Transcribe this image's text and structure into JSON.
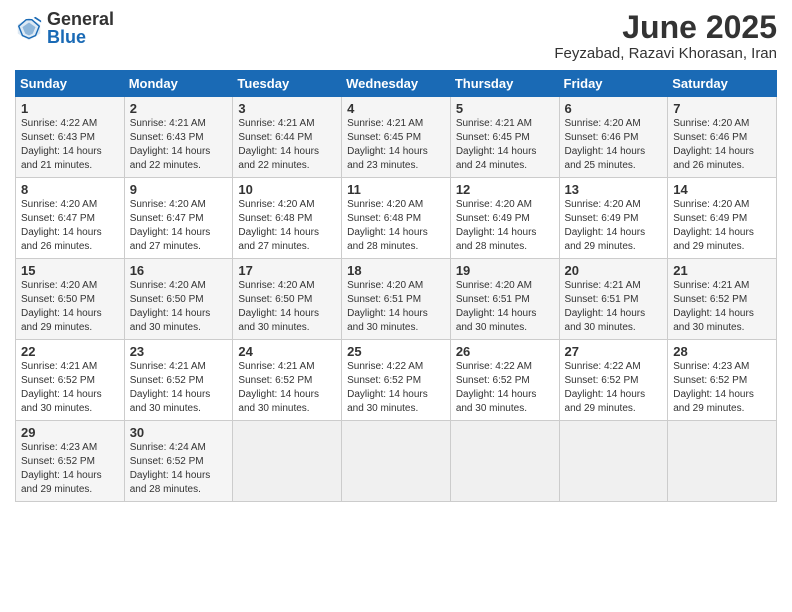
{
  "header": {
    "logo_general": "General",
    "logo_blue": "Blue",
    "title": "June 2025",
    "subtitle": "Feyzabad, Razavi Khorasan, Iran"
  },
  "weekdays": [
    "Sunday",
    "Monday",
    "Tuesday",
    "Wednesday",
    "Thursday",
    "Friday",
    "Saturday"
  ],
  "weeks": [
    [
      {
        "day": "1",
        "info": "Sunrise: 4:22 AM\nSunset: 6:43 PM\nDaylight: 14 hours\nand 21 minutes."
      },
      {
        "day": "2",
        "info": "Sunrise: 4:21 AM\nSunset: 6:43 PM\nDaylight: 14 hours\nand 22 minutes."
      },
      {
        "day": "3",
        "info": "Sunrise: 4:21 AM\nSunset: 6:44 PM\nDaylight: 14 hours\nand 22 minutes."
      },
      {
        "day": "4",
        "info": "Sunrise: 4:21 AM\nSunset: 6:45 PM\nDaylight: 14 hours\nand 23 minutes."
      },
      {
        "day": "5",
        "info": "Sunrise: 4:21 AM\nSunset: 6:45 PM\nDaylight: 14 hours\nand 24 minutes."
      },
      {
        "day": "6",
        "info": "Sunrise: 4:20 AM\nSunset: 6:46 PM\nDaylight: 14 hours\nand 25 minutes."
      },
      {
        "day": "7",
        "info": "Sunrise: 4:20 AM\nSunset: 6:46 PM\nDaylight: 14 hours\nand 26 minutes."
      }
    ],
    [
      {
        "day": "8",
        "info": "Sunrise: 4:20 AM\nSunset: 6:47 PM\nDaylight: 14 hours\nand 26 minutes."
      },
      {
        "day": "9",
        "info": "Sunrise: 4:20 AM\nSunset: 6:47 PM\nDaylight: 14 hours\nand 27 minutes."
      },
      {
        "day": "10",
        "info": "Sunrise: 4:20 AM\nSunset: 6:48 PM\nDaylight: 14 hours\nand 27 minutes."
      },
      {
        "day": "11",
        "info": "Sunrise: 4:20 AM\nSunset: 6:48 PM\nDaylight: 14 hours\nand 28 minutes."
      },
      {
        "day": "12",
        "info": "Sunrise: 4:20 AM\nSunset: 6:49 PM\nDaylight: 14 hours\nand 28 minutes."
      },
      {
        "day": "13",
        "info": "Sunrise: 4:20 AM\nSunset: 6:49 PM\nDaylight: 14 hours\nand 29 minutes."
      },
      {
        "day": "14",
        "info": "Sunrise: 4:20 AM\nSunset: 6:49 PM\nDaylight: 14 hours\nand 29 minutes."
      }
    ],
    [
      {
        "day": "15",
        "info": "Sunrise: 4:20 AM\nSunset: 6:50 PM\nDaylight: 14 hours\nand 29 minutes."
      },
      {
        "day": "16",
        "info": "Sunrise: 4:20 AM\nSunset: 6:50 PM\nDaylight: 14 hours\nand 30 minutes."
      },
      {
        "day": "17",
        "info": "Sunrise: 4:20 AM\nSunset: 6:50 PM\nDaylight: 14 hours\nand 30 minutes."
      },
      {
        "day": "18",
        "info": "Sunrise: 4:20 AM\nSunset: 6:51 PM\nDaylight: 14 hours\nand 30 minutes."
      },
      {
        "day": "19",
        "info": "Sunrise: 4:20 AM\nSunset: 6:51 PM\nDaylight: 14 hours\nand 30 minutes."
      },
      {
        "day": "20",
        "info": "Sunrise: 4:21 AM\nSunset: 6:51 PM\nDaylight: 14 hours\nand 30 minutes."
      },
      {
        "day": "21",
        "info": "Sunrise: 4:21 AM\nSunset: 6:52 PM\nDaylight: 14 hours\nand 30 minutes."
      }
    ],
    [
      {
        "day": "22",
        "info": "Sunrise: 4:21 AM\nSunset: 6:52 PM\nDaylight: 14 hours\nand 30 minutes."
      },
      {
        "day": "23",
        "info": "Sunrise: 4:21 AM\nSunset: 6:52 PM\nDaylight: 14 hours\nand 30 minutes."
      },
      {
        "day": "24",
        "info": "Sunrise: 4:21 AM\nSunset: 6:52 PM\nDaylight: 14 hours\nand 30 minutes."
      },
      {
        "day": "25",
        "info": "Sunrise: 4:22 AM\nSunset: 6:52 PM\nDaylight: 14 hours\nand 30 minutes."
      },
      {
        "day": "26",
        "info": "Sunrise: 4:22 AM\nSunset: 6:52 PM\nDaylight: 14 hours\nand 30 minutes."
      },
      {
        "day": "27",
        "info": "Sunrise: 4:22 AM\nSunset: 6:52 PM\nDaylight: 14 hours\nand 29 minutes."
      },
      {
        "day": "28",
        "info": "Sunrise: 4:23 AM\nSunset: 6:52 PM\nDaylight: 14 hours\nand 29 minutes."
      }
    ],
    [
      {
        "day": "29",
        "info": "Sunrise: 4:23 AM\nSunset: 6:52 PM\nDaylight: 14 hours\nand 29 minutes."
      },
      {
        "day": "30",
        "info": "Sunrise: 4:24 AM\nSunset: 6:52 PM\nDaylight: 14 hours\nand 28 minutes."
      },
      {
        "day": "",
        "info": ""
      },
      {
        "day": "",
        "info": ""
      },
      {
        "day": "",
        "info": ""
      },
      {
        "day": "",
        "info": ""
      },
      {
        "day": "",
        "info": ""
      }
    ]
  ]
}
